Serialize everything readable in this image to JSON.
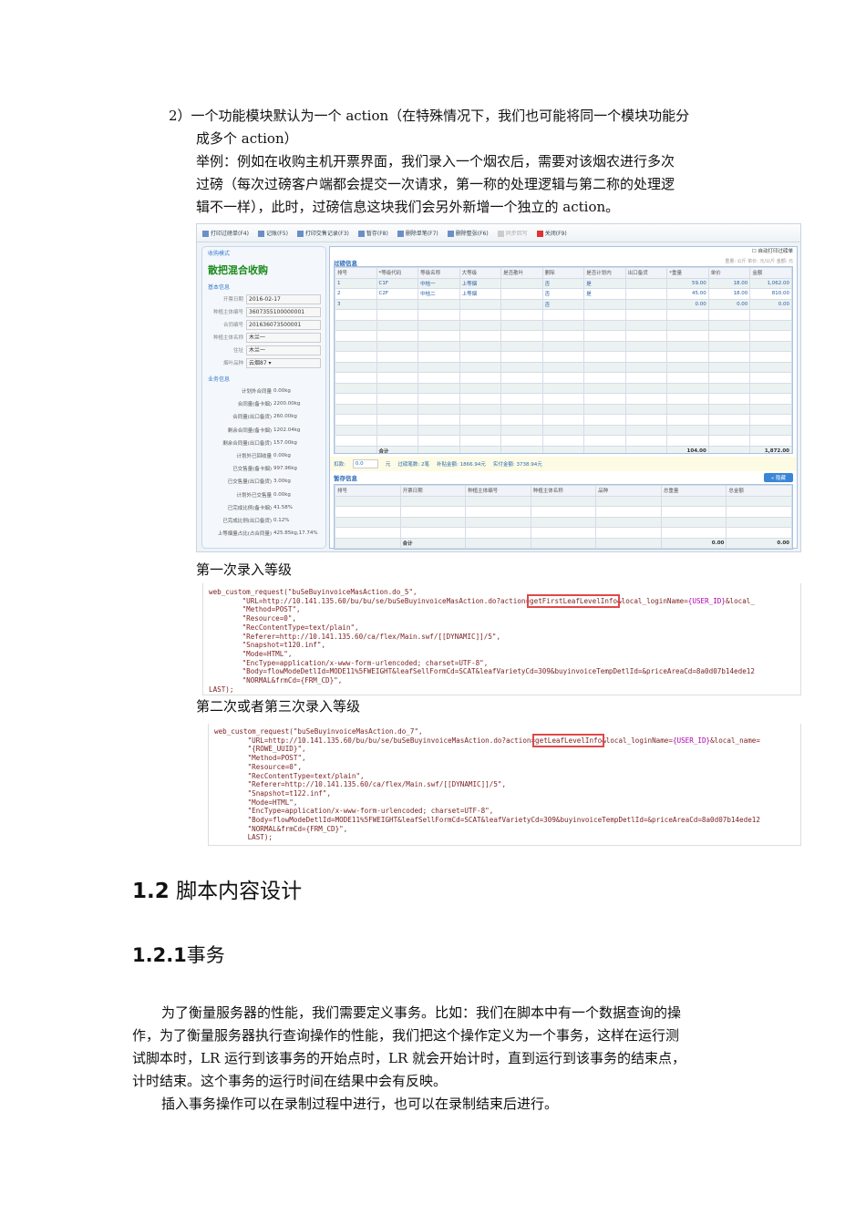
{
  "intro": {
    "lines": [
      "2）一个功能模块默认为一个 action（在特殊情况下，我们也可能将同一个模块功能分",
      "成多个 action）",
      "举例：例如在收购主机开票界面，我们录入一个烟农后，需要对该烟农进行多次",
      "过磅（每次过磅客户端都会提交一次请求，第一称的处理逻辑与第二称的处理逻",
      "辑不一样），此时，过磅信息这块我们会另外新增一个独立的 action。"
    ]
  },
  "screenshot": {
    "toolbar": [
      "打印过磅单(F4)",
      "记账(F5)",
      "打印交售记录(F3)",
      "暂存(F8)",
      "删除单笔(F7)",
      "删除整张(F6)",
      "同步回写",
      "关闭(F9)"
    ],
    "mode_label": "收购模式",
    "mode": "散把混合收购",
    "basic_label": "基本信息",
    "basic": [
      [
        "开票日期",
        "2016-02-17"
      ],
      [
        "种植主体编号",
        "3607355100000001"
      ],
      [
        "合同编号",
        "201636073500001"
      ],
      [
        "种植主体名称",
        "木兰一"
      ],
      [
        "住址",
        "木兰一"
      ],
      [
        "烟叶品种",
        "云烟87"
      ]
    ],
    "biz_label": "业务信息",
    "biz": [
      [
        "计划外合同量",
        "0.00kg"
      ],
      [
        "合同量(备卡烟)",
        "2200.00kg"
      ],
      [
        "合同量(出口备货)",
        "260.00kg"
      ],
      [
        "剩余合同量(备卡烟)",
        "1202.04kg"
      ],
      [
        "剩余合同量(出口备货)",
        "157.00kg"
      ],
      [
        "计划外已回收量",
        "0.00kg"
      ],
      [
        "已交售量(备卡烟)",
        "997.96kg"
      ],
      [
        "已交售量(出口备货)",
        "3.00kg"
      ],
      [
        "计划外已交售量",
        "0.00kg"
      ],
      [
        "已完成比例(备卡烟)",
        "41.58%"
      ],
      [
        "已完成比例(出口备货)",
        "0.12%"
      ],
      [
        "上等烟量占比(占合同量)",
        "425.85kg,17.74%"
      ]
    ],
    "auto_print": "自动打印过磅单",
    "weigh_title": "过磅信息",
    "units": "重量: 公斤  单价: 元/公斤  金额: 元",
    "weigh_headers": [
      "排号",
      "*等级代码",
      "等级名称",
      "大等级",
      "是否散叶",
      "删除",
      "是否计划内",
      "出口备货",
      "*重量",
      "单价",
      "金额"
    ],
    "weigh_rows": [
      [
        "1",
        "C1F",
        "中桔一",
        "上等烟",
        "",
        "否",
        "是",
        "",
        "59.00",
        "18.00",
        "1,062.00"
      ],
      [
        "2",
        "C2F",
        "中桔二",
        "上等烟",
        "",
        "否",
        "是",
        "",
        "45.00",
        "18.00",
        "810.00"
      ],
      [
        "3",
        "",
        "",
        "",
        "",
        "否",
        "",
        "",
        "0.00",
        "0.00",
        "0.00"
      ]
    ],
    "weigh_total": [
      "",
      "合计",
      "",
      "",
      "",
      "",
      "",
      "",
      "104.00",
      "",
      "1,872.00"
    ],
    "summary": {
      "deduct_label": "扣款:",
      "deduct_value": "0.0",
      "yuan": "元",
      "count": "过磅笔数: 2笔",
      "subsidy": "补贴金额: 1866.94元",
      "actual": "实付金额: 3738.94元"
    },
    "temp_title": "暂存信息",
    "hide_button": "« 隐藏",
    "temp_headers": [
      "排号",
      "开票日期",
      "种植主体编号",
      "种植主体名称",
      "品种",
      "总重量",
      "总金额"
    ],
    "temp_total": [
      "",
      "合计",
      "",
      "",
      "",
      "0.00",
      "0.00"
    ]
  },
  "caption1": "第一次录入等级",
  "code1": {
    "pre": [
      "web_custom_request(\"buSeBuyinvoiceMasAction.do_5\",",
      "\t\"URL=http://10.141.135.60/bu/bu/se/buSeBuyinvoiceMasAction.do?action="
    ],
    "hl": "getFirstLeafLevelInfo",
    "after": "&local_loginName=",
    "var": "{USER_ID}",
    "tail": "&local_",
    "lines": [
      "\t\"Method=POST\",",
      "\t\"Resource=0\",",
      "\t\"RecContentType=text/plain\",",
      "\t\"Referer=http://10.141.135.60/ca/flex/Main.swf/[[DYNAMIC]]/5\",",
      "\t\"Snapshot=t120.inf\",",
      "\t\"Mode=HTML\",",
      "\t\"EncType=application/x-www-form-urlencoded; charset=UTF-8\",",
      "\t\"Body=flowModeDetlId=MODE11%5FWEIGHT&leafSellFormCd=SCAT&leafVarietyCd=309&buyinvoiceTempDetlId=&priceAreaCd=8a0d07b14ede12",
      "\t\"NORMAL&frmCd={FRM_CD}\",",
      "LAST);"
    ]
  },
  "caption2": "第二次或者第三次录入等级",
  "code2": {
    "pre": [
      "web_custom_request(\"buSeBuyinvoiceMasAction.do_7\",",
      "\t\"URL=http://10.141.135.60/bu/bu/se/buSeBuyinvoiceMasAction.do?action="
    ],
    "hl": "getLeafLevelInfo",
    "after": "&local_loginName=",
    "var": "{USER_ID}",
    "tail": "&local_name=",
    "lines": [
      "\t\"{ROWE_UUID}\",",
      "\t\"Method=POST\",",
      "\t\"Resource=0\",",
      "\t\"RecContentType=text/plain\",",
      "\t\"Referer=http://10.141.135.60/ca/flex/Main.swf/[[DYNAMIC]]/5\",",
      "\t\"Snapshot=t122.inf\",",
      "\t\"Mode=HTML\",",
      "\t\"EncType=application/x-www-form-urlencoded; charset=UTF-8\",",
      "\t\"Body=flowModeDetlId=MODE11%5FWEIGHT&leafSellFormCd=SCAT&leafVarietyCd=309&buyinvoiceTempDetlId=&priceAreaCd=8a0d07b14ede12",
      "\t\"NORMAL&frmCd={FRM_CD}\",",
      "\tLAST);"
    ]
  },
  "h12": {
    "num": "1.2",
    "text": "脚本内容设计"
  },
  "h121": {
    "num": "1.2.1",
    "text": "事务"
  },
  "body": [
    "为了衡量服务器的性能，我们需要定义事务。比如：我们在脚本中有一个数据查询的操",
    "作，为了衡量服务器执行查询操作的性能，我们把这个操作定义为一个事务，这样在运行测",
    "试脚本时，LR 运行到该事务的开始点时，LR 就会开始计时，直到运行到该事务的结束点，",
    "计时结束。这个事务的运行时间在结果中会有反映。",
    "插入事务操作可以在录制过程中进行，也可以在录制结束后进行。"
  ]
}
